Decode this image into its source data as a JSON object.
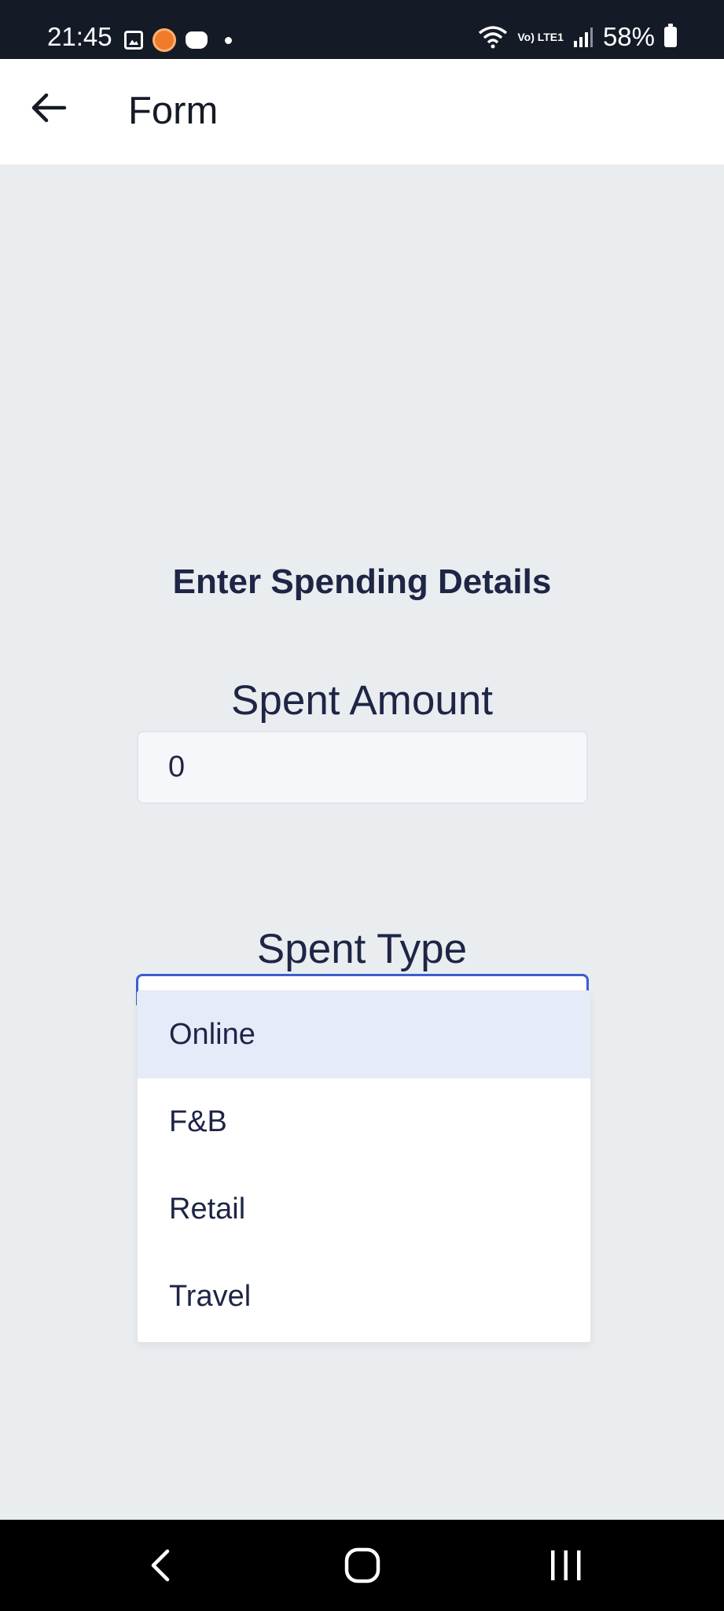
{
  "status_bar": {
    "time": "21:45",
    "lte_label": "Vo) LTE1",
    "battery_percent": "58%",
    "icons": [
      "gallery-icon",
      "orange-app-icon",
      "game-icon",
      "notification-dot-icon",
      "wifi-icon",
      "lte-icon",
      "signal-icon",
      "battery-icon"
    ]
  },
  "app_bar": {
    "title": "Form",
    "back_icon": "arrow-left-icon"
  },
  "form": {
    "heading": "Enter Spending Details",
    "amount": {
      "label": "Spent Amount",
      "value": "0"
    },
    "type": {
      "label": "Spent Type",
      "options": [
        "Online",
        "F&B",
        "Retail",
        "Travel"
      ],
      "highlighted_option": "Online"
    }
  },
  "nav_bar": {
    "icons": [
      "nav-back-icon",
      "nav-home-icon",
      "nav-recents-icon"
    ]
  },
  "colors": {
    "status_bar_bg": "#151b26",
    "page_bg": "#e9edf0",
    "text_primary": "#1e2545",
    "select_focus": "#3b5ecf",
    "option_highlight": "#e5ebf8"
  }
}
